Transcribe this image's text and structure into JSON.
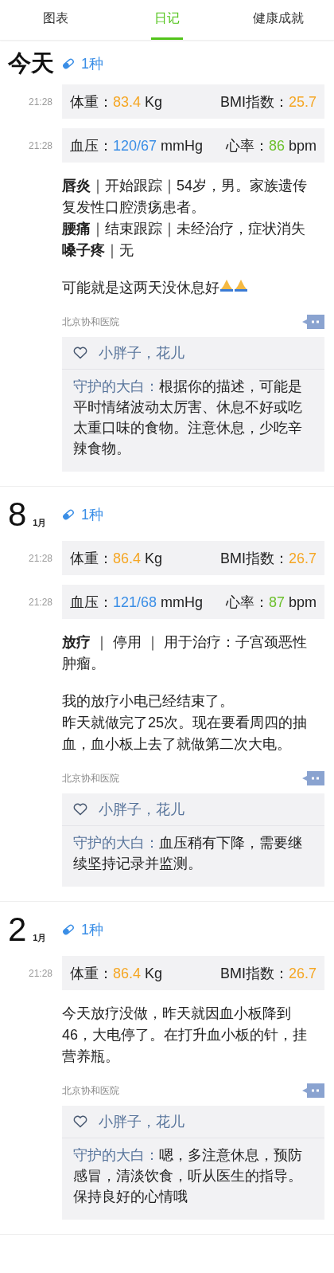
{
  "tabs": [
    {
      "label": "图表",
      "selected": false
    },
    {
      "label": "日记",
      "selected": true
    },
    {
      "label": "健康成就",
      "selected": false
    }
  ],
  "days": [
    {
      "day": "今天",
      "medication": "1种",
      "records": [
        {
          "kind": "weight",
          "time": "21:28",
          "label": "体重：",
          "value": "83.4",
          "unit": "Kg",
          "label2": "BMI指数：",
          "value2": "25.7"
        },
        {
          "kind": "bp",
          "time": "21:28",
          "label": "血压：",
          "value": "120/67",
          "unit": "mmHg",
          "label2": "心率：",
          "value2": "86",
          "unit2": "bpm"
        }
      ],
      "notes": [
        [
          "**唇炎**｜开始跟踪｜54岁，男。家族遗传复发性口腔溃疡患者。",
          "**腰痛**｜结束跟踪｜未经治疗，症状消失",
          "**嗓子疼**｜无"
        ],
        [
          "可能就是这两天没休息好"
        ]
      ],
      "prayer_emoji": true,
      "hospital": "北京协和医院",
      "likes": "小胖子，花儿",
      "reply": {
        "author": "守护的大白：",
        "text": "根据你的描述，可能是平时情绪波动太厉害、休息不好或吃太重口味的食物。注意休息，少吃辛辣食物。"
      }
    },
    {
      "day": "8",
      "month": "1月",
      "medication": "1种",
      "records": [
        {
          "kind": "weight",
          "time": "21:28",
          "label": "体重：",
          "value": "86.4",
          "unit": "Kg",
          "label2": "BMI指数：",
          "value2": "26.7"
        },
        {
          "kind": "bp",
          "time": "21:28",
          "label": "血压：",
          "value": "121/68",
          "unit": "mmHg",
          "label2": "心率：",
          "value2": "87",
          "unit2": "bpm"
        }
      ],
      "notes": [
        [
          "**放疗** ｜ 停用 ｜ 用于治疗：子宫颈恶性肿瘤。"
        ],
        [
          "我的放疗小电已经结束了。",
          "昨天就做完了25次。现在要看周四的抽血，血小板上去了就做第二次大电。"
        ]
      ],
      "hospital": "北京协和医院",
      "likes": "小胖子，花儿",
      "reply": {
        "author": "守护的大白：",
        "text": "血压稍有下降，需要继续坚持记录并监测。"
      }
    },
    {
      "day": "2",
      "month": "1月",
      "medication": "1种",
      "records": [
        {
          "kind": "weight",
          "time": "21:28",
          "label": "体重：",
          "value": "86.4",
          "unit": "Kg",
          "label2": "BMI指数：",
          "value2": "26.7"
        }
      ],
      "notes": [
        [
          "今天放疗没做，昨天就因血小板降到46，大电停了。在打升血小板的针，挂营养瓶。"
        ]
      ],
      "hospital": "北京协和医院",
      "likes": "小胖子，花儿",
      "reply": {
        "author": "守护的大白：",
        "text": "嗯，多注意休息，预防感冒，清淡饮食，听从医生的指导。保持良好的心情哦"
      }
    }
  ]
}
